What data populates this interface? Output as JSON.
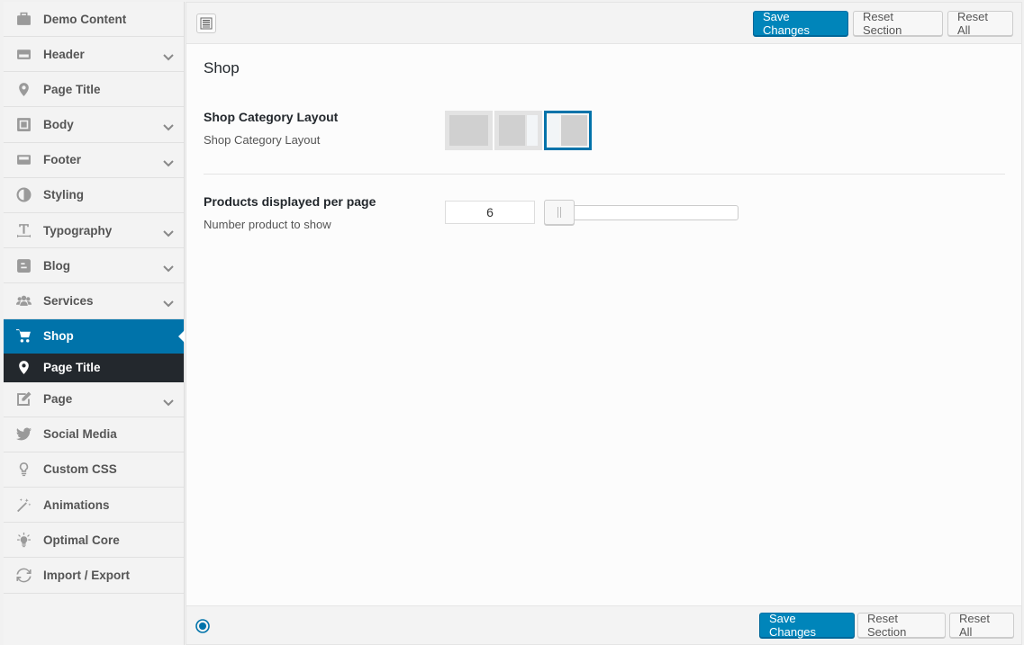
{
  "sidebar": {
    "items": [
      {
        "label": "Demo Content",
        "icon": "briefcase-icon",
        "has_submenu": false
      },
      {
        "label": "Header",
        "icon": "header-icon",
        "has_submenu": true
      },
      {
        "label": "Page Title",
        "icon": "location-pin-icon",
        "has_submenu": false
      },
      {
        "label": "Body",
        "icon": "body-layout-icon",
        "has_submenu": true
      },
      {
        "label": "Footer",
        "icon": "footer-icon",
        "has_submenu": true
      },
      {
        "label": "Styling",
        "icon": "half-circle-icon",
        "has_submenu": false
      },
      {
        "label": "Typography",
        "icon": "text-icon",
        "has_submenu": true
      },
      {
        "label": "Blog",
        "icon": "blogger-icon",
        "has_submenu": true
      },
      {
        "label": "Services",
        "icon": "users-icon",
        "has_submenu": true
      },
      {
        "label": "Shop",
        "icon": "cart-icon",
        "has_submenu": false,
        "active": true
      },
      {
        "label": "Page Title",
        "icon": "location-pin-icon",
        "has_submenu": false,
        "subitem": true
      },
      {
        "label": "Page",
        "icon": "edit-page-icon",
        "has_submenu": true
      },
      {
        "label": "Social Media",
        "icon": "twitter-icon",
        "has_submenu": false
      },
      {
        "label": "Custom CSS",
        "icon": "lightbulb-icon",
        "has_submenu": false
      },
      {
        "label": "Animations",
        "icon": "magic-wand-icon",
        "has_submenu": false
      },
      {
        "label": "Optimal Core",
        "icon": "bulb-rays-icon",
        "has_submenu": false
      },
      {
        "label": "Import / Export",
        "icon": "refresh-icon",
        "has_submenu": false
      }
    ]
  },
  "toolbar": {
    "save_label": "Save Changes",
    "reset_section_label": "Reset Section",
    "reset_all_label": "Reset All"
  },
  "section": {
    "title": "Shop",
    "fields": {
      "layout": {
        "title": "Shop Category Layout",
        "desc": "Shop Category Layout",
        "options": [
          "full-width",
          "right-sidebar",
          "left-sidebar"
        ],
        "selected": "left-sidebar"
      },
      "per_page": {
        "title": "Products displayed per page",
        "desc": "Number product to show",
        "value": "6"
      }
    }
  },
  "colors": {
    "accent": "#0073aa",
    "primary_button": "#0085ba",
    "submenu_bg": "#23282d"
  }
}
